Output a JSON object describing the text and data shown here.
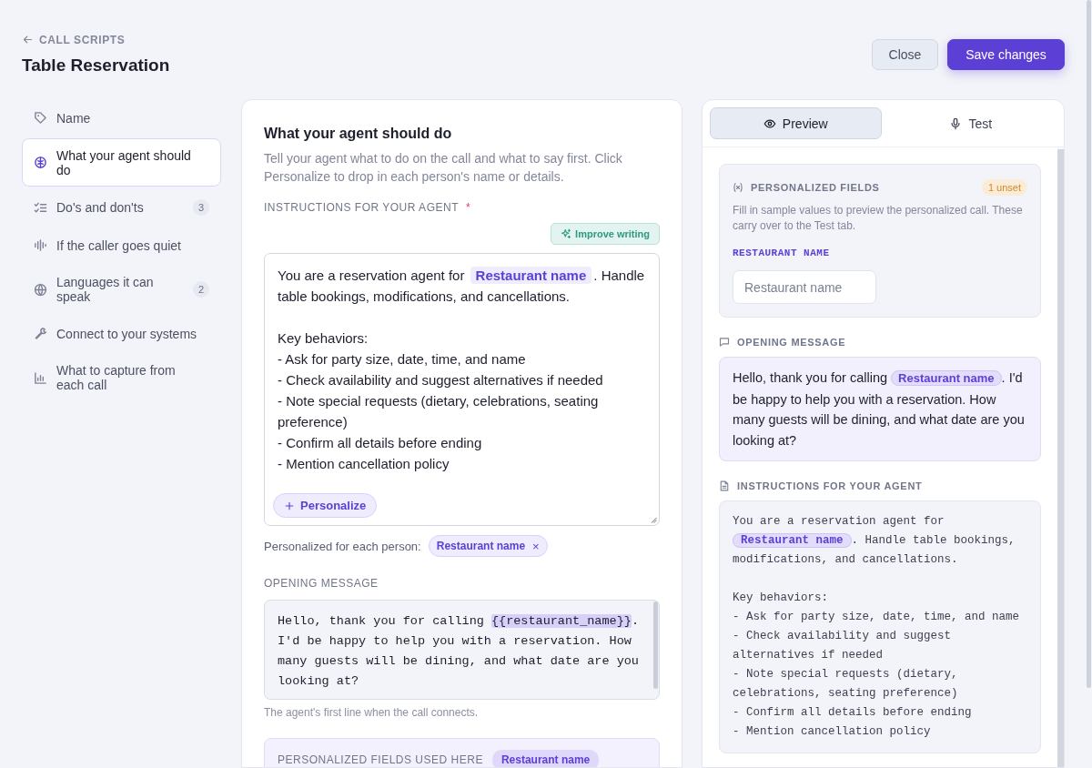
{
  "header": {
    "back_link": "CALL SCRIPTS",
    "title": "Table Reservation"
  },
  "buttons": [
    {
      "label": "Close",
      "kind": "secondary"
    },
    {
      "label": "Save changes",
      "kind": "primary"
    }
  ],
  "sidebar": {
    "items": [
      {
        "label": "Name",
        "selected": false
      },
      {
        "label": "What your agent should do",
        "selected": true
      },
      {
        "label": "Do's and don'ts",
        "selected": false,
        "count": "3"
      },
      {
        "label": "If the caller goes quiet",
        "selected": false
      },
      {
        "label": "Languages it can speak",
        "selected": false,
        "count": "2"
      },
      {
        "label": "Connect to your systems",
        "selected": false
      },
      {
        "label": "What to capture from each call",
        "selected": false
      }
    ]
  },
  "editor": {
    "heading": "What your agent should do",
    "description": "Tell your agent what to do on the call and what to say first. Click Personalize to drop in each person's name or details.",
    "instructions": {
      "label": "INSTRUCTIONS FOR YOUR AGENT",
      "required": true,
      "required_mark": "*",
      "improve_button": "Improve writing",
      "segments": [
        {
          "kind": "text",
          "text": "You are a reservation agent for "
        },
        {
          "kind": "chip",
          "text": "Restaurant name"
        },
        {
          "kind": "text",
          "text": ". Handle table bookings, modifications, and cancellations.\n\nKey behaviors:\n- Ask for party size, date, time, and name\n- Check availability and suggest alternatives if needed\n- Note special requests (dietary, celebrations, seating preference)\n- Confirm all details before ending\n- Mention cancellation policy"
        }
      ],
      "personalize_button": "Personalize"
    },
    "personalized_for": {
      "label": "Personalized for each person:",
      "chips": [
        {
          "label": "Restaurant name",
          "remove": "×"
        }
      ]
    },
    "opening_message": {
      "label": "OPENING MESSAGE",
      "segments": [
        {
          "kind": "text",
          "text": "Hello, thank you for calling "
        },
        {
          "kind": "token",
          "text": "{{restaurant_name}}"
        },
        {
          "kind": "text",
          "text": ". I'd be happy to help you with a reservation. How many guests will be dining, and what date are you looking at?"
        }
      ],
      "hint": "The agent's first line when the call connects."
    },
    "used_here": {
      "label": "PERSONALIZED FIELDS USED HERE",
      "chips": [
        {
          "label": "Restaurant name"
        }
      ]
    }
  },
  "preview": {
    "tabs": [
      {
        "label": "Preview",
        "selected": true
      },
      {
        "label": "Test",
        "selected": false
      }
    ],
    "fields_card": {
      "title": "PERSONALIZED FIELDS",
      "badge": "1 unset",
      "description": "Fill in sample values to preview the personalized call. These carry over to the Test tab.",
      "field_label": "RESTAURANT NAME",
      "placeholder": "Restaurant name"
    },
    "opening_message": {
      "title": "OPENING MESSAGE",
      "segments": [
        {
          "kind": "text",
          "text": "Hello, thank you for calling "
        },
        {
          "kind": "chip",
          "text": "Restaurant name"
        },
        {
          "kind": "text",
          "text": ". I'd be happy to help you with a reservation. How many guests will be dining, and what date are you looking at?"
        }
      ]
    },
    "instructions": {
      "title": "INSTRUCTIONS FOR YOUR AGENT",
      "segments": [
        {
          "kind": "text",
          "text": "You are a reservation agent for "
        },
        {
          "kind": "chip",
          "text": "Restaurant name"
        },
        {
          "kind": "text",
          "text": ". Handle table bookings, modifications, and cancellations.\n\nKey behaviors:\n- Ask for party size, date, time, and name\n- Check availability and suggest alternatives if needed\n- Note special requests (dietary, celebrations, seating preference)\n- Confirm all details before ending\n- Mention cancellation policy"
        }
      ]
    }
  }
}
